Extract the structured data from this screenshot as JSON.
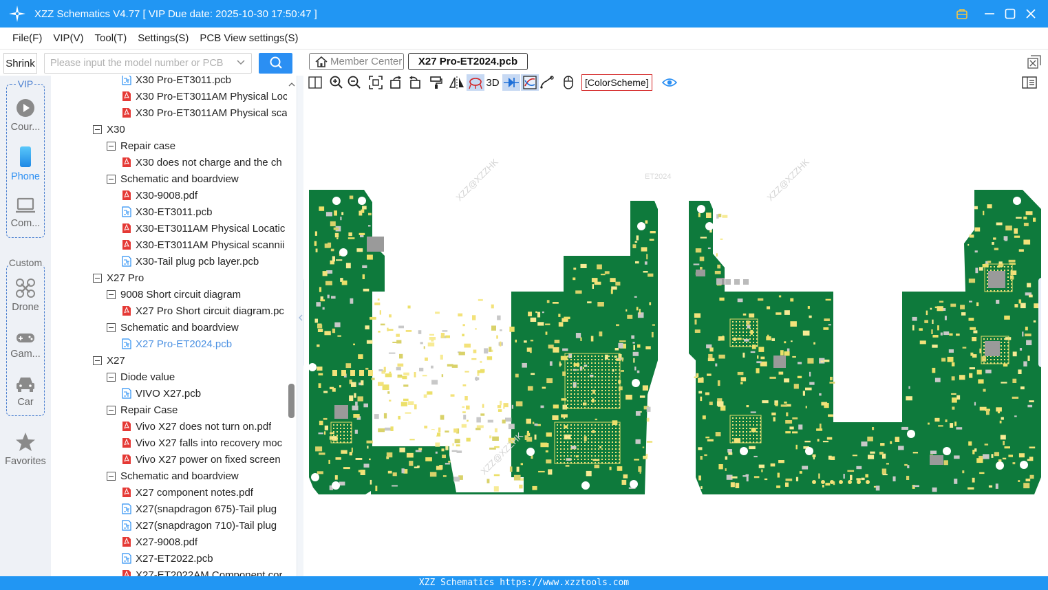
{
  "window": {
    "title": "XZZ Schematics V4.77 [ VIP Due date: 2025-10-30 17:50:47 ]",
    "colors": {
      "primary": "#2196F3",
      "pcb_green": "#0e7a3c",
      "selected_text": "#4a90e2"
    }
  },
  "menu": [
    "File(F)",
    "VIP(V)",
    "Tool(T)",
    "Settings(S)",
    "PCB View settings(S)"
  ],
  "search": {
    "shrink_label": "Shrink",
    "placeholder": "Please input the model number or PCB",
    "value": ""
  },
  "rail": {
    "vip_label": "VIP",
    "custom_label": "Custom",
    "items": [
      {
        "label": "Cour...",
        "icon": "play-icon"
      },
      {
        "label": "Phone",
        "icon": "phone-icon",
        "active": true
      },
      {
        "label": "Com...",
        "icon": "laptop-icon"
      },
      {
        "label": "Drone",
        "icon": "drone-icon"
      },
      {
        "label": "Gam...",
        "icon": "gamepad-icon"
      },
      {
        "label": "Car",
        "icon": "car-icon"
      },
      {
        "label": "Favorites",
        "icon": "star-icon"
      }
    ]
  },
  "tree": [
    {
      "label": "X30 Pro-ET3011.pcb",
      "type": "pcb",
      "level": 3
    },
    {
      "label": "X30 Pro-ET3011AM Physical Loc",
      "type": "pdf",
      "level": 3
    },
    {
      "label": "X30 Pro-ET3011AM Physical sca",
      "type": "pdf",
      "level": 3
    },
    {
      "label": "X30",
      "type": "folder",
      "level": 1
    },
    {
      "label": "Repair case",
      "type": "folder",
      "level": 2
    },
    {
      "label": "X30 does not charge and the ch",
      "type": "pdf",
      "level": 3
    },
    {
      "label": "Schematic and boardview",
      "type": "folder",
      "level": 2
    },
    {
      "label": "X30-9008.pdf",
      "type": "pdf",
      "level": 3
    },
    {
      "label": "X30-ET3011.pcb",
      "type": "pcb",
      "level": 3
    },
    {
      "label": "X30-ET3011AM Physical Locatic",
      "type": "pdf",
      "level": 3
    },
    {
      "label": "X30-ET3011AM Physical scannii",
      "type": "pdf",
      "level": 3
    },
    {
      "label": "X30-Tail plug pcb layer.pcb",
      "type": "pcb",
      "level": 3
    },
    {
      "label": "X27 Pro",
      "type": "folder",
      "level": 1
    },
    {
      "label": "9008 Short circuit diagram",
      "type": "folder",
      "level": 2
    },
    {
      "label": "X27 Pro Short circuit diagram.pc",
      "type": "pdf",
      "level": 3
    },
    {
      "label": "Schematic and boardview",
      "type": "folder",
      "level": 2
    },
    {
      "label": "X27 Pro-ET2024.pcb",
      "type": "pcb",
      "level": 3,
      "selected": true
    },
    {
      "label": "X27",
      "type": "folder",
      "level": 1
    },
    {
      "label": "Diode value",
      "type": "folder",
      "level": 2
    },
    {
      "label": "VIVO X27.pcb",
      "type": "pcb",
      "level": 3
    },
    {
      "label": "Repair Case",
      "type": "folder",
      "level": 2
    },
    {
      "label": "Vivo X27 does not turn on.pdf",
      "type": "pdf",
      "level": 3
    },
    {
      "label": "Vivo X27 falls into recovery moc",
      "type": "pdf",
      "level": 3
    },
    {
      "label": "Vivo X27 power on fixed screen",
      "type": "pdf",
      "level": 3
    },
    {
      "label": "Schematic and boardview",
      "type": "folder",
      "level": 2
    },
    {
      "label": "X27 component notes.pdf",
      "type": "pdf",
      "level": 3
    },
    {
      "label": "X27(snapdragon 675)-Tail plug",
      "type": "pcb",
      "level": 3
    },
    {
      "label": "X27(snapdragon 710)-Tail plug",
      "type": "pcb",
      "level": 3
    },
    {
      "label": "X27-9008.pdf",
      "type": "pdf",
      "level": 3
    },
    {
      "label": "X27-ET2022.pcb",
      "type": "pcb",
      "level": 3
    },
    {
      "label": "X27-ET2022AM Component cor",
      "type": "pdf",
      "level": 3
    }
  ],
  "tabs": {
    "member_center": "Member Center",
    "active": "X27 Pro-ET2024.pcb"
  },
  "toolbar": {
    "three_d": "3D",
    "color_scheme": "[ColorScheme]"
  },
  "board": {
    "label": "ET2024",
    "watermarks": [
      "XZZ@XZZHK",
      "XZZ@XZZHK",
      "XZZ@XZZHK"
    ]
  },
  "status": "XZZ Schematics https://www.xzztools.com"
}
